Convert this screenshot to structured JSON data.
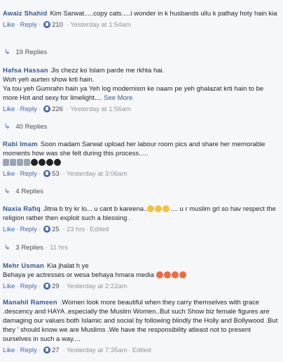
{
  "comments": [
    {
      "author": "Awaiz Shahid",
      "text": "Kim Sarwat.....copy cats.....i wonder in k husbands ullu k pathay hoty hain kia",
      "like": "Like",
      "reply": "Reply",
      "likes": "210",
      "time": "Yesterday at 1:54am",
      "replies": "19 Replies"
    },
    {
      "author": "Hafsa Hassan",
      "text": "Jis chezz ko Islam parde me rkhta hai.",
      "text2": "Woh yeh aurten show krti hain.",
      "text3": "Ya tou yeh Gumrahn hain ya Yeh log modernism ke naam pe yeh ghalazat krti hain to be more Hot and sexy for limelight....",
      "see_more": "See More",
      "like": "Like",
      "reply": "Reply",
      "likes": "226",
      "time": "Yesterday at 1:56am",
      "replies": "40 Replies"
    },
    {
      "author": "Rabi Imam",
      "text": "Soon madam Sarwat upload her labour room pics and share her memorable moments how was she felt during this process.....",
      "like": "Like",
      "reply": "Reply",
      "likes": "53",
      "time": "Yesterday at 3:06am",
      "replies": "4 Replies"
    },
    {
      "author": "Naxia Rafiq",
      "text": "Jitna b try kr lo... u cant b kareena..",
      "text_after": ".... u r muslim grl so hav respect the religion rather then exploit such a blessing .",
      "like": "Like",
      "reply": "Reply",
      "likes": "25",
      "time": "23 hrs",
      "edited": "Edited",
      "replies": "3 Replies",
      "replies_time": "11 hrs"
    },
    {
      "author": "Mehr Usman",
      "text": "Kia jhalat h ye",
      "text2": "Behaya ye actresses or wesa behaya hmara media",
      "like": "Like",
      "reply": "Reply",
      "likes": "29",
      "time": "Yesterday at 2:22am"
    },
    {
      "author": "Manahil Rameen",
      "text": ".Women look more beautiful when they carry themselves with grace .descency and HAYA .especially the Muslim Women..But such Show biz female figures are damaging our values both Islamic and social by following blindly the Holly and Bollywood .But they ' should know we are Muslims .We have the responsibility atleast not to present ourselves in such a way....",
      "like": "Like",
      "reply": "Reply",
      "likes": "27",
      "time": "Yesterday at 7:35am",
      "edited": "Edited"
    }
  ],
  "icons": {
    "like": "thumbs-up-icon",
    "reply_arrow": "reply-arrow-icon"
  },
  "colors": {
    "link": "#4267b2",
    "author": "#365899",
    "meta": "#90949c"
  }
}
